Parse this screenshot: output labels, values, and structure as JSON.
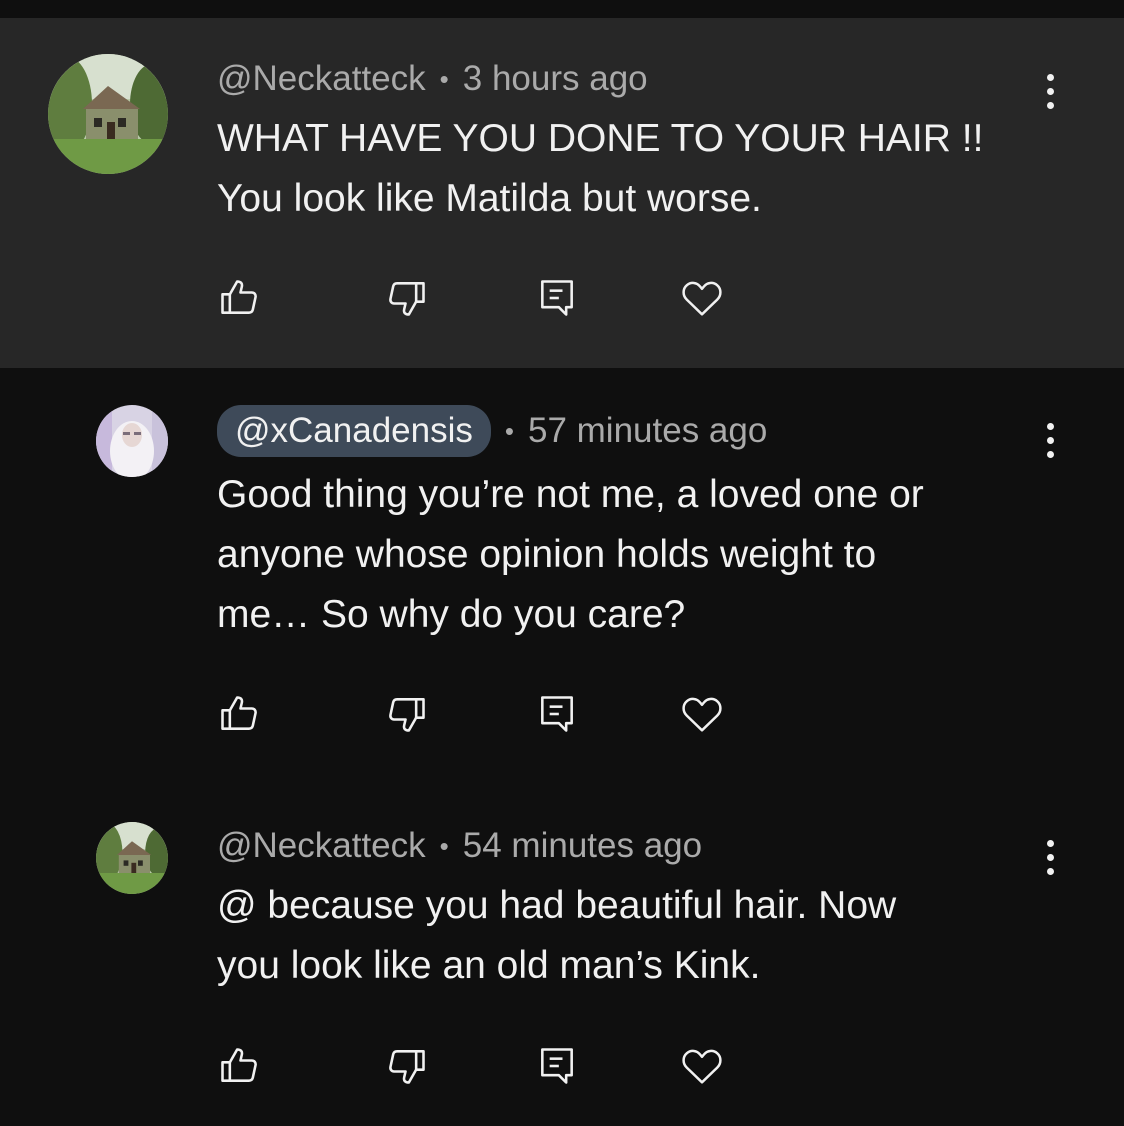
{
  "comments": [
    {
      "handle": "@Neckatteck",
      "separator": "•",
      "time": "3 hours ago",
      "lines": [
        "WHAT HAVE YOU DONE TO YOUR HAIR !!",
        "You look like Matilda but worse."
      ]
    },
    {
      "handle": "@xCanadensis",
      "separator": "•",
      "time": "57 minutes ago",
      "lines": [
        "Good thing you’re not me, a loved one or",
        "anyone whose opinion holds weight to",
        "me… So why do you care?"
      ]
    },
    {
      "handle": "@Neckatteck",
      "separator": "•",
      "time": "54 minutes ago",
      "lines": [
        "@ because you had beautiful hair. Now",
        "you look like an old man’s Kink."
      ]
    }
  ],
  "actions": [
    "like-icon",
    "dislike-icon",
    "reply-icon",
    "heart-icon"
  ],
  "colors": {
    "background": "#0f0f0f",
    "highlight": "#272727",
    "text": "#f1f1f1",
    "meta": "#aaaaaa",
    "chip": "#3e4a59"
  }
}
